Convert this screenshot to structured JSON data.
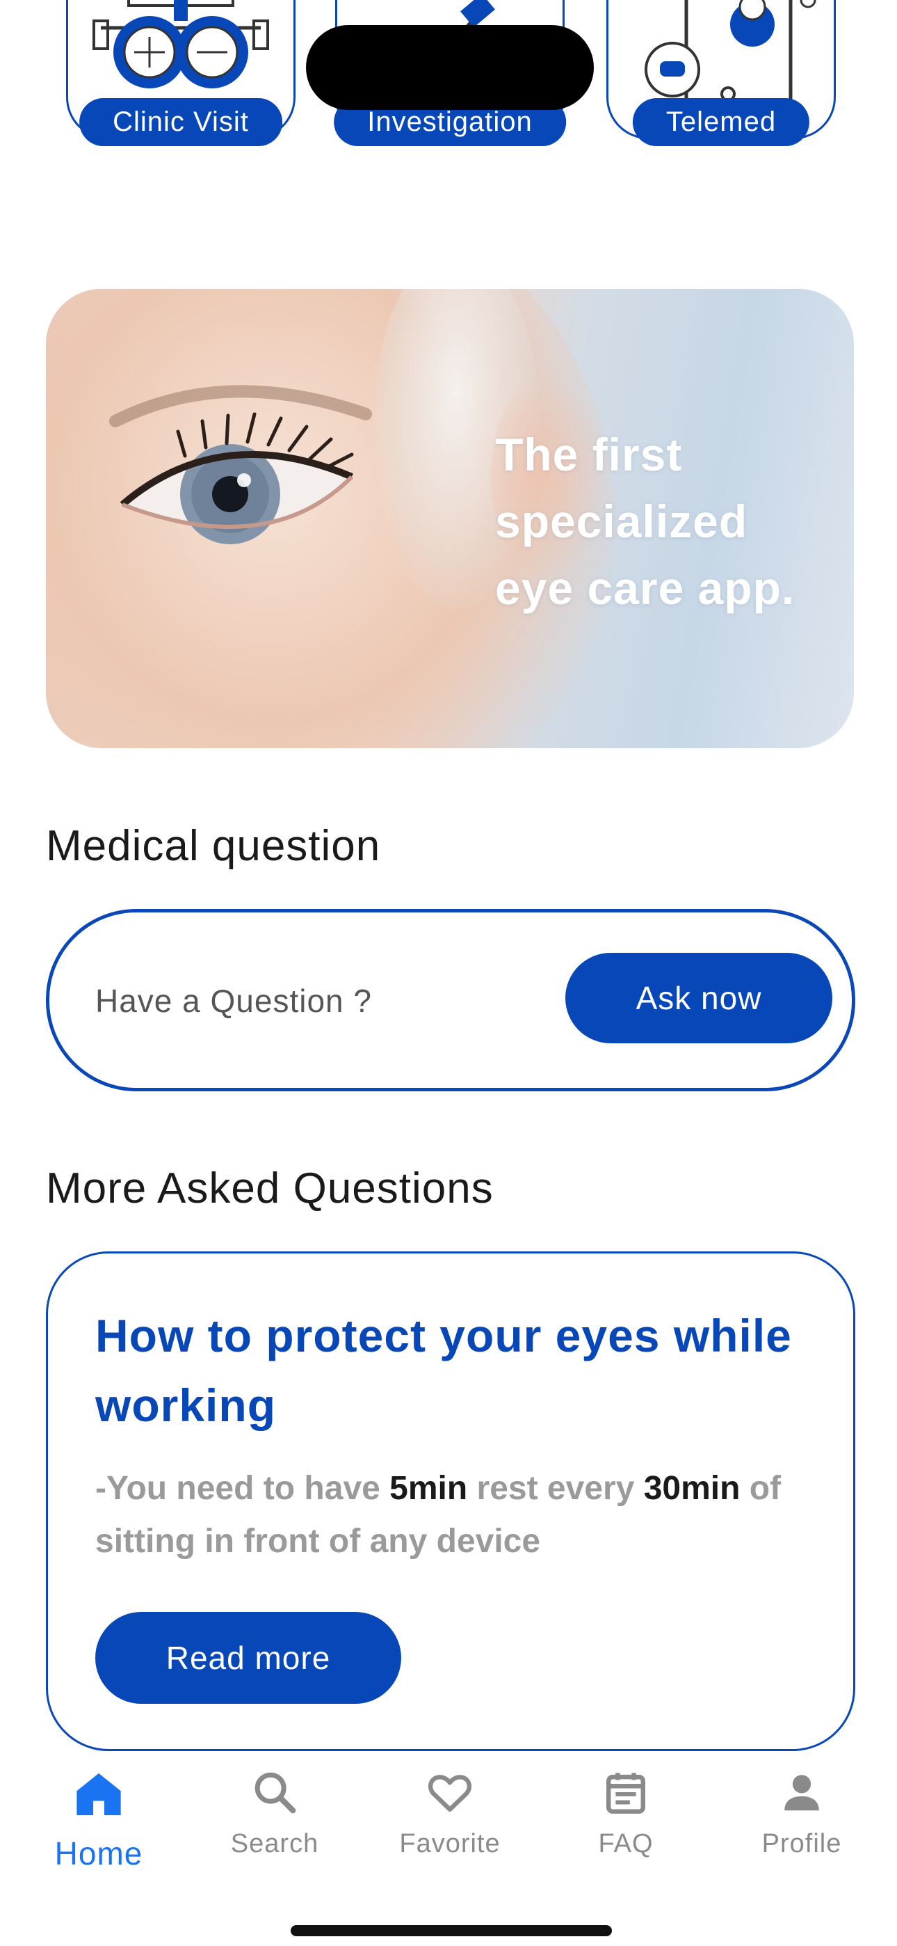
{
  "services": [
    {
      "label": "Clinic Visit",
      "icon": "eye-exam-frame-icon"
    },
    {
      "label": "Investigation",
      "icon": "eye-dropper-icon"
    },
    {
      "label": "Telemed",
      "icon": "doctor-on-phone-icon"
    }
  ],
  "hero": {
    "line1": "The first",
    "line2": "specialized",
    "line3": "eye care app."
  },
  "medical": {
    "title": "Medical question",
    "placeholder": "Have a Question ?",
    "button": "Ask now"
  },
  "faq_section": {
    "title": "More Asked Questions",
    "card": {
      "title": "How to protect your eyes while working",
      "body_part1": "-You need to have ",
      "body_bold1": "5min",
      "body_part2": " rest every ",
      "body_bold2": "30min",
      "body_part3": " of sitting in front of any device",
      "button": "Read more"
    }
  },
  "tabs": [
    {
      "label": "Home",
      "icon": "home-icon",
      "active": true
    },
    {
      "label": "Search",
      "icon": "search-icon",
      "active": false
    },
    {
      "label": "Favorite",
      "icon": "heart-icon",
      "active": false
    },
    {
      "label": "FAQ",
      "icon": "calendar-icon",
      "active": false
    },
    {
      "label": "Profile",
      "icon": "person-icon",
      "active": false
    }
  ],
  "colors": {
    "brand_blue": "#0847b7",
    "active_tab": "#1a73f0",
    "inactive_tab": "#8a8a8a"
  }
}
